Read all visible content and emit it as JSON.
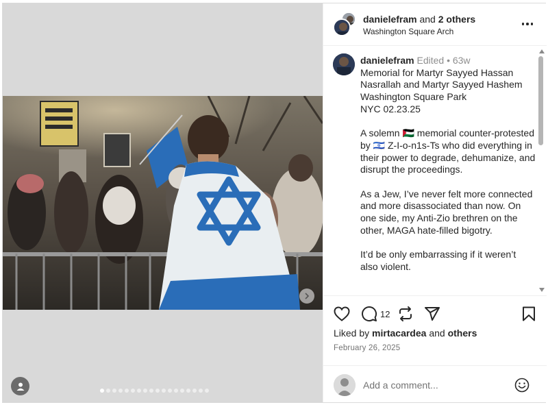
{
  "post": {
    "header": {
      "username": "danielefram",
      "and_text": " and ",
      "others_text": "2 others",
      "location": "Washington Square Arch"
    },
    "caption": {
      "username": "danielefram",
      "meta": " Edited • 63w",
      "paragraphs": [
        [
          "Memorial for Martyr Sayyed Hassan Nasrallah and Martyr Sayyed Hashem",
          "Washington Square Park",
          "NYC 02.23.25"
        ],
        [
          "A solemn 🇵🇸 memorial counter-protested by 🇮🇱 Z-I-o-n1s-Ts who did everything in their power to degrade, dehumanize, and disrupt the proceedings."
        ],
        [
          "As a Jew, I’ve never felt more connected and more disassociated than now. On one side, my Anti-Zio brethren on the other, MAGA hate-filled bigotry."
        ],
        [
          "It’d be only embarrassing if it weren’t also violent."
        ]
      ]
    },
    "actions": {
      "like_icon": "heart-icon",
      "comment_icon": "comment-icon",
      "comment_count": "12",
      "repost_icon": "repost-icon",
      "share_icon": "send-icon",
      "save_icon": "bookmark-icon"
    },
    "likes": {
      "prefix": "Liked by ",
      "user": "mirtacardea",
      "middle": " and ",
      "others": "others"
    },
    "date": "February 26, 2025",
    "comment": {
      "placeholder": "Add a comment...",
      "emoji_icon": "smiley-icon"
    },
    "carousel": {
      "slide_count": 18,
      "active_index": 0
    }
  },
  "colors": {
    "flag_blue": "#2a6db8",
    "text": "#262626",
    "muted": "#8e8e8e",
    "media_bg": "#d9d9d9"
  }
}
